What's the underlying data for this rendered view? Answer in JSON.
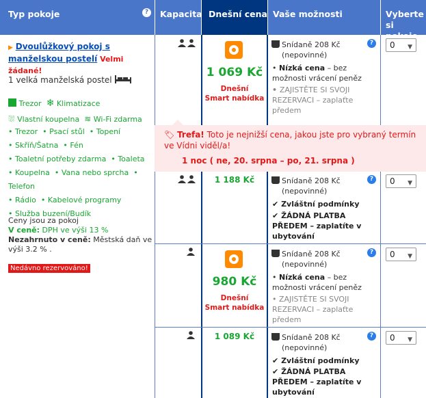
{
  "headers": {
    "room_type": "Typ pokoje",
    "capacity": "Kapacita",
    "today_price": "Dnešní cena",
    "your_options": "Vaše možnosti",
    "select_rooms": "Vyberte si pokoje"
  },
  "room": {
    "name": "Dvoulůžkový pokoj s manželskou postelí",
    "demand": "Velmi žádané!",
    "bed": "1 velká manželská postel",
    "facilities_top": [
      "Trezor",
      "Klimatizace",
      "Vlastní koupelna",
      "Wi-Fi zdarma"
    ],
    "facilities": [
      "Trezor",
      "Psací stůl",
      "Topení",
      "Skříň/Šatna",
      "Fén",
      "Toaletní potřeby zdarma",
      "Toaleta",
      "Koupelna",
      "Vana nebo sprcha",
      "Telefon",
      "Rádio",
      "Kabelové programy",
      "Služba buzení/Budík"
    ],
    "price_note": "Ceny jsou za pokoj",
    "vat_label": "V ceně:",
    "vat_value": "DPH ve výši 13 %",
    "excl_label": "Nezahrnuto v ceně:",
    "excl_value": "Městská daň ve výši 3.2 % .",
    "recent_badge": "Nedávno rezervováno!"
  },
  "tip": {
    "label": "Trefa!",
    "text": "Toto je nejnižší cena, jakou jste pro vybraný termín ve Vídni viděl/a!",
    "dates": "1 noc ( ne, 20. srpna – po, 21. srpna )"
  },
  "rows": [
    {
      "price": "1 069 Kč",
      "smart_label_1": "Dnešní",
      "smart_label_2": "Smart nabídka",
      "breakfast": "Snídaně 208 Kč",
      "optional": "(nepovinné)",
      "opt1_bold": "Nízká cena",
      "opt1_rest": "– bez možnosti vrácení peněz",
      "opt2": "ZAJISTĚTE SI SVOJI REZERVACI – zaplaťte předem",
      "select": "0"
    },
    {
      "price": "1 188 Kč",
      "breakfast": "Snídaně 208 Kč",
      "optional": "(nepovinné)",
      "opt1": "Zvláštní podmínky",
      "opt2": "ŽÁDNÁ PLATBA PŘEDEM – zaplatíte v ubytování",
      "select": "0"
    },
    {
      "price": "980 Kč",
      "smart_label_1": "Dnešní",
      "smart_label_2": "Smart nabídka",
      "breakfast": "Snídaně 208 Kč",
      "optional": "(nepovinné)",
      "opt1_bold": "Nízká cena",
      "opt1_rest": "– bez možnosti vrácení peněz",
      "opt2": "ZAJISTĚTE SI SVOJI REZERVACI – zaplaťte předem",
      "select": "0"
    },
    {
      "price": "1 089 Kč",
      "breakfast": "Snídaně 208 Kč",
      "optional": "(nepovinné)",
      "opt1": "Zvláštní podmínky",
      "opt2": "ŽÁDNÁ PLATBA PŘEDEM – zaplatíte v ubytování",
      "select": "0"
    }
  ]
}
